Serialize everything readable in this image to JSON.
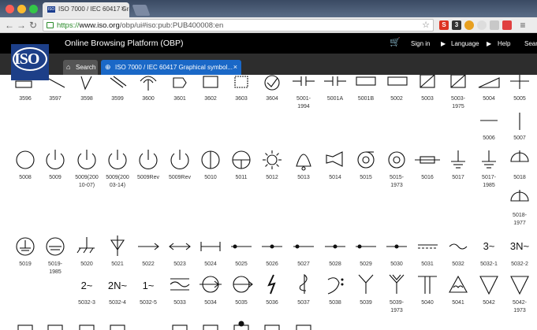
{
  "browser": {
    "tab_title": "ISO 7000 / IEC 60417 Gra",
    "url_scheme": "https://",
    "url_host": "www.iso.org",
    "url_path": "/obp/ui#iso:pub:PUB400008:en",
    "ext_badge": "3"
  },
  "app": {
    "title": "Online Browsing Platform (OBP)",
    "nav": [
      "Sign in",
      "Language",
      "Help",
      "Sear"
    ],
    "logo": "ISO"
  },
  "tabs": {
    "search": "Search",
    "document": "ISO 7000 / IEC 60417 Graphical symbol..."
  },
  "rows": [
    {
      "codes": [
        "3596",
        "3597",
        "3598",
        "3599",
        "3600",
        "3601",
        "3602",
        "3603",
        "3604",
        "5001-\n1994",
        "5001A",
        "5001B",
        "5002",
        "5003",
        "5003-\n1975",
        "5004",
        "5005"
      ]
    },
    {
      "codes": [
        "5006",
        "5007"
      ]
    },
    {
      "codes": [
        "5008",
        "5009",
        "5009(200\n10-07)",
        "5009(200\n03-14)",
        "5009Rev",
        "5009Rev",
        "5010",
        "5011",
        "5012",
        "5013",
        "5014",
        "5015",
        "5015-\n1973",
        "5016",
        "5017",
        "5017-\n1985",
        "5018"
      ]
    },
    {
      "codes": [
        "5018-\n1977"
      ]
    },
    {
      "codes": [
        "5019",
        "5019-\n1985",
        "5020",
        "5021",
        "5022",
        "5023",
        "5024",
        "5025",
        "5026",
        "5027",
        "5028",
        "5029",
        "5030",
        "5031",
        "5032",
        "5032-1",
        "5032-2"
      ]
    },
    {
      "codes": [
        "5032-3",
        "5032-4",
        "5032-5",
        "5033",
        "5034",
        "5035",
        "5036",
        "5037",
        "5038",
        "5039",
        "5039-\n1973",
        "5040",
        "5041",
        "5042",
        "5042-\n1973"
      ]
    }
  ],
  "glyph_text": {
    "g5032_1": "3~",
    "g5032_2": "3N~",
    "g5032_3": "2~",
    "g5032_4": "2N~",
    "g5032_5": "1~"
  }
}
